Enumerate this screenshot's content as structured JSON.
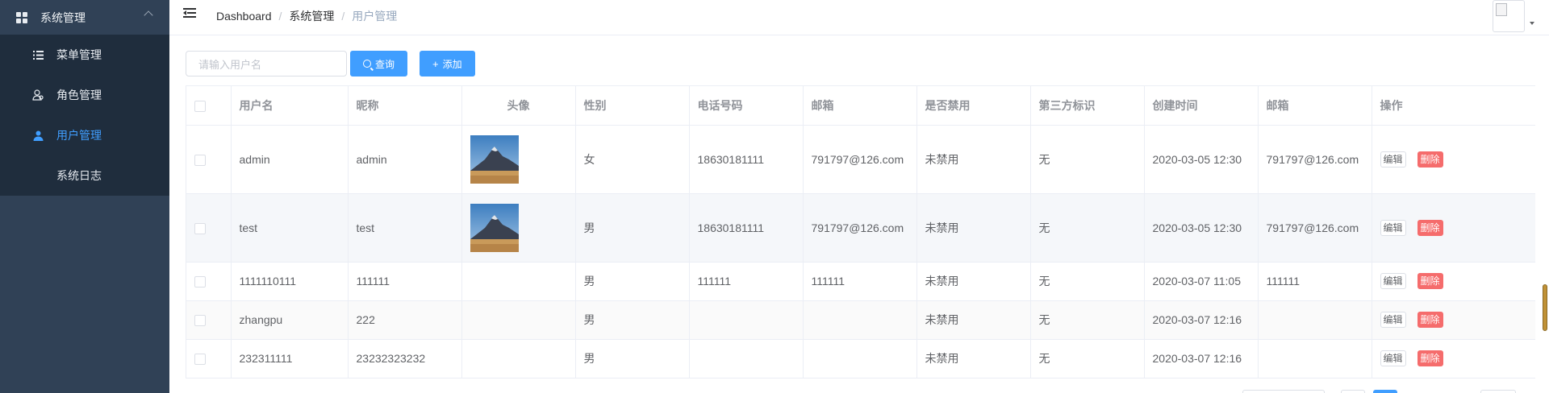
{
  "sidebar": {
    "group_title": "系统管理",
    "items": [
      {
        "label": "菜单管理",
        "icon": "list-icon",
        "active": false
      },
      {
        "label": "角色管理",
        "icon": "user-outline-icon",
        "active": false
      },
      {
        "label": "用户管理",
        "icon": "user-icon",
        "active": true
      },
      {
        "label": "系统日志",
        "icon": "",
        "active": false
      }
    ]
  },
  "header": {
    "breadcrumb": [
      "Dashboard",
      "系统管理",
      "用户管理"
    ],
    "separator": "/"
  },
  "toolbar": {
    "search_placeholder": "请输入用户名",
    "search_label": "查询",
    "add_label": "添加",
    "add_icon": "+"
  },
  "table": {
    "columns": [
      "用户名",
      "昵称",
      "头像",
      "性别",
      "电话号码",
      "邮箱",
      "是否禁用",
      "第三方标识",
      "创建时间",
      "邮箱",
      "操作"
    ],
    "rows": [
      {
        "username": "admin",
        "nickname": "admin",
        "has_avatar": true,
        "gender": "女",
        "phone": "18630181111",
        "email": "791797@126.com",
        "disabled": "未禁用",
        "third": "无",
        "created": "2020-03-05 12:30",
        "email2": "791797@126.com"
      },
      {
        "username": "test",
        "nickname": "test",
        "has_avatar": true,
        "gender": "男",
        "phone": "18630181111",
        "email": "791797@126.com",
        "disabled": "未禁用",
        "third": "无",
        "created": "2020-03-05 12:30",
        "email2": "791797@126.com"
      },
      {
        "username": "1111110111",
        "nickname": "111111",
        "has_avatar": false,
        "gender": "男",
        "phone": "111111",
        "email": "111111",
        "disabled": "未禁用",
        "third": "无",
        "created": "2020-03-07 11:05",
        "email2": "111111"
      },
      {
        "username": "zhangpu",
        "nickname": "222",
        "has_avatar": false,
        "gender": "男",
        "phone": "",
        "email": "",
        "disabled": "未禁用",
        "third": "无",
        "created": "2020-03-07 12:16",
        "email2": ""
      },
      {
        "username": "232311111",
        "nickname": "23232323232",
        "has_avatar": false,
        "gender": "男",
        "phone": "",
        "email": "",
        "disabled": "未禁用",
        "third": "无",
        "created": "2020-03-07 12:16",
        "email2": ""
      }
    ],
    "edit_label": "编辑",
    "delete_label": "删除"
  },
  "colors": {
    "sidebar_bg": "#304156",
    "submenu_bg": "#1f2d3d",
    "primary": "#409eff",
    "danger": "#f56c6c"
  }
}
